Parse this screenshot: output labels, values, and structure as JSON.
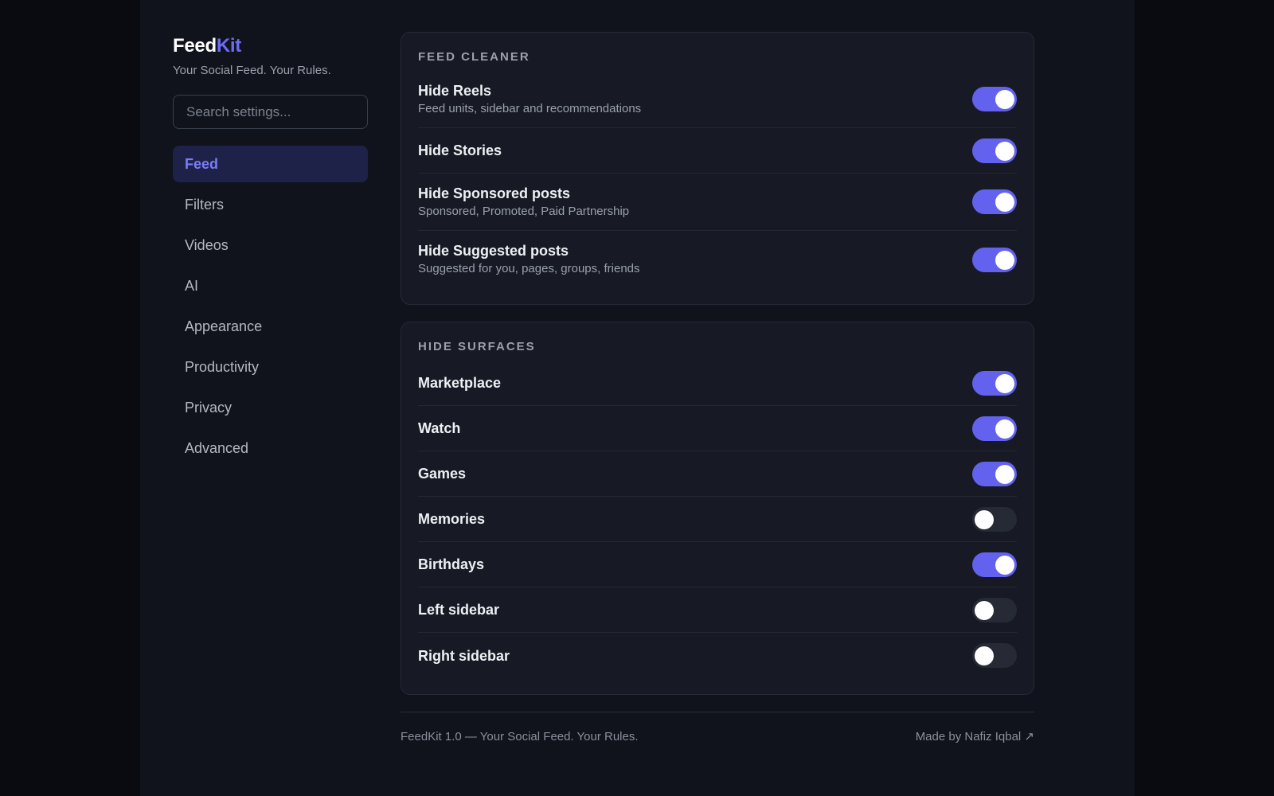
{
  "brand": {
    "part1": "Feed",
    "part2": "Kit",
    "tagline": "Your Social Feed. Your Rules."
  },
  "search": {
    "placeholder": "Search settings..."
  },
  "nav": [
    {
      "label": "Feed",
      "active": true
    },
    {
      "label": "Filters"
    },
    {
      "label": "Videos"
    },
    {
      "label": "AI"
    },
    {
      "label": "Appearance"
    },
    {
      "label": "Productivity"
    },
    {
      "label": "Privacy"
    },
    {
      "label": "Advanced"
    }
  ],
  "feed_cleaner": {
    "title": "FEED CLEANER",
    "items": [
      {
        "label": "Hide Reels",
        "desc": "Feed units, sidebar and recommendations",
        "on": true
      },
      {
        "label": "Hide Stories",
        "desc": "",
        "on": true
      },
      {
        "label": "Hide Sponsored posts",
        "desc": "Sponsored, Promoted, Paid Partnership",
        "on": true
      },
      {
        "label": "Hide Suggested posts",
        "desc": "Suggested for you, pages, groups, friends",
        "on": true
      }
    ]
  },
  "hide_surfaces": {
    "title": "HIDE SURFACES",
    "items": [
      {
        "label": "Marketplace",
        "on": true
      },
      {
        "label": "Watch",
        "on": true
      },
      {
        "label": "Games",
        "on": true
      },
      {
        "label": "Memories",
        "on": false
      },
      {
        "label": "Birthdays",
        "on": true
      },
      {
        "label": "Left sidebar",
        "on": false
      },
      {
        "label": "Right sidebar",
        "on": false
      }
    ]
  },
  "footer": {
    "left": "FeedKit 1.0 — Your Social Feed. Your Rules.",
    "right": "Made by Nafiz Iqbal ↗"
  },
  "colors": {
    "accent": "#6262ee",
    "nav_active_bg": "#1e2148",
    "nav_active_text": "#7b7cf7",
    "toggle_off": "#262a35",
    "card_bg": "#171a24",
    "page_bg": "#10131b"
  }
}
